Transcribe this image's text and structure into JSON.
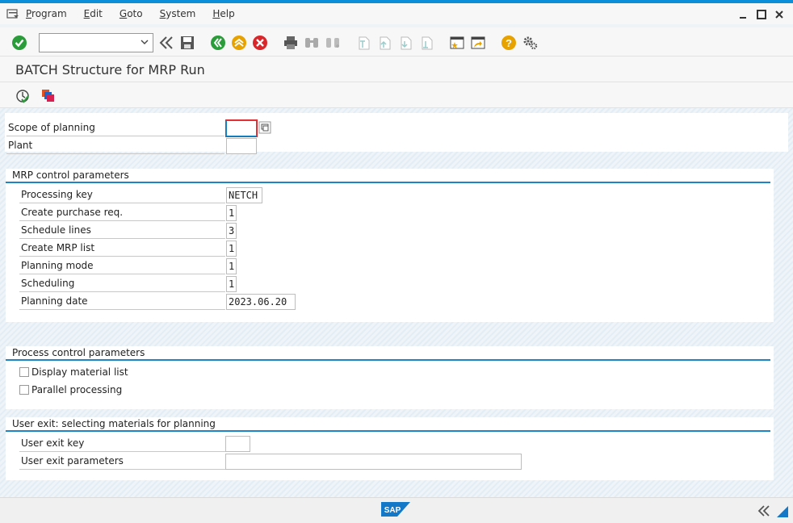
{
  "menu": {
    "items": [
      {
        "underline": "P",
        "rest": "rogram"
      },
      {
        "underline": "E",
        "rest": "dit"
      },
      {
        "underline": "G",
        "rest": "oto"
      },
      {
        "underline": "S",
        "rest": "ystem"
      },
      {
        "underline": "H",
        "rest": "elp"
      }
    ]
  },
  "toolbar": {
    "command_field_value": ""
  },
  "page": {
    "title": "BATCH Structure for MRP Run"
  },
  "top_fields": {
    "scope_label": "Scope of planning",
    "scope_value": "",
    "plant_label": "Plant",
    "plant_value": ""
  },
  "mrp_group": {
    "title": "MRP control parameters",
    "rows": [
      {
        "label": "Processing key",
        "value": "NETCH"
      },
      {
        "label": "Create purchase req.",
        "value": "1"
      },
      {
        "label": "Schedule lines",
        "value": "3"
      },
      {
        "label": "Create MRP list",
        "value": "1"
      },
      {
        "label": "Planning mode",
        "value": "1"
      },
      {
        "label": "Scheduling",
        "value": "1"
      },
      {
        "label": "Planning date",
        "value": "2023.06.20"
      }
    ]
  },
  "process_group": {
    "title": "Process control parameters",
    "checkboxes": [
      {
        "label": "Display material list",
        "checked": false
      },
      {
        "label": "Parallel processing",
        "checked": false
      }
    ]
  },
  "user_exit_group": {
    "title": "User exit: selecting materials for planning",
    "key_label": "User exit key",
    "key_value": "",
    "params_label": "User exit parameters",
    "params_value": ""
  },
  "status": {
    "logo_text": "SAP"
  },
  "colors": {
    "accent": "#1c85c8",
    "topbar": "#0a8fd8"
  }
}
